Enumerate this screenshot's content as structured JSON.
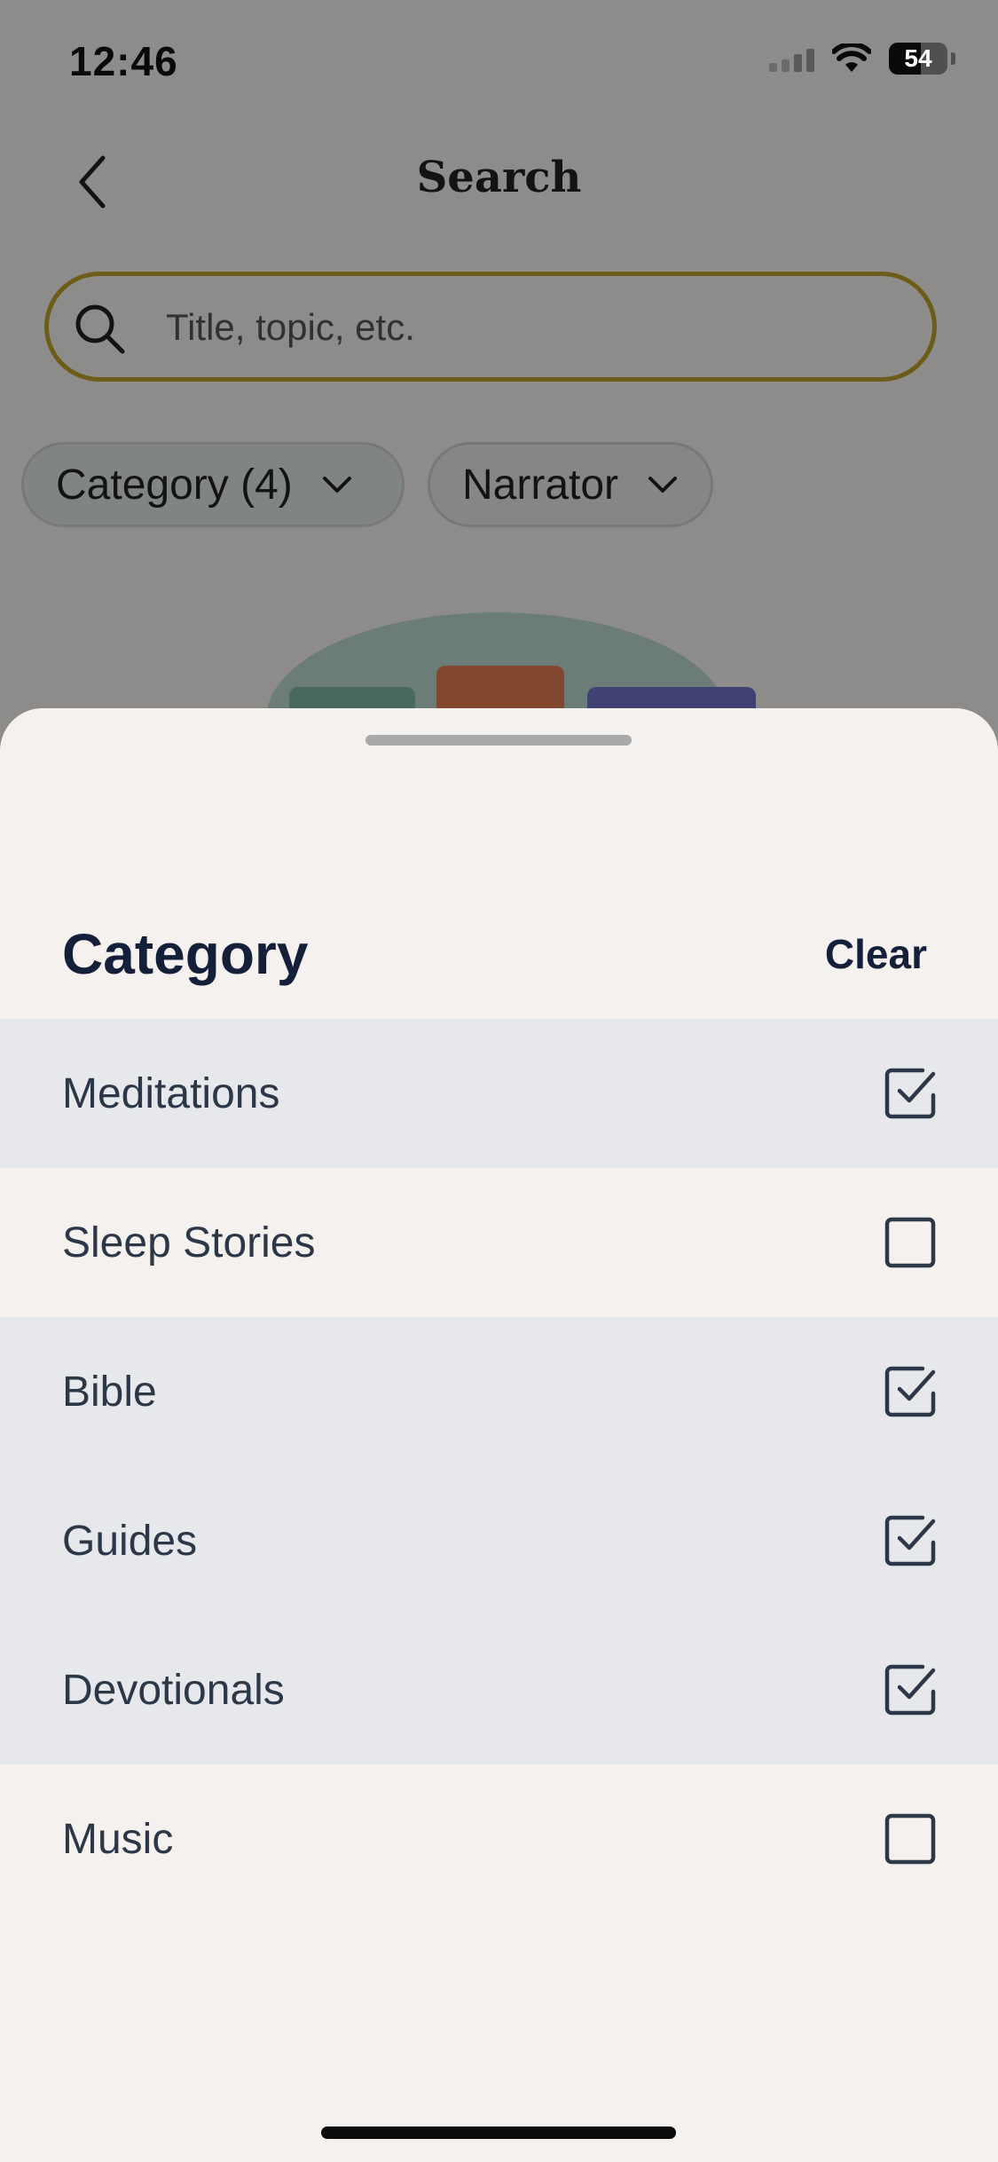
{
  "status_bar": {
    "time": "12:46",
    "battery": "54"
  },
  "nav": {
    "title": "Search"
  },
  "search": {
    "placeholder": "Title, topic, etc."
  },
  "filters": {
    "category_label": "Category (4)",
    "narrator_label": "Narrator"
  },
  "sheet": {
    "title": "Category",
    "clear_label": "Clear",
    "options": [
      {
        "label": "Meditations",
        "checked": true
      },
      {
        "label": "Sleep Stories",
        "checked": false
      },
      {
        "label": "Bible",
        "checked": true
      },
      {
        "label": "Guides",
        "checked": true
      },
      {
        "label": "Devotionals",
        "checked": true
      },
      {
        "label": "Music",
        "checked": false
      }
    ]
  },
  "icons": {
    "back": "chevron-left-icon",
    "search": "magnifier-icon",
    "chip_dropdown": "chevron-down-icon",
    "checkbox_on": "checkbox-checked-icon",
    "checkbox_off": "checkbox-empty-icon"
  },
  "colors": {
    "search_border": "#b89f2a",
    "sheet_bg": "#f5f1ee",
    "selected_row": "#e6e8eb",
    "title_text": "#14203a",
    "illus_green": "#b9d8cc",
    "illus_card_1": "#7fb3a2",
    "illus_card_2": "#e07a52",
    "illus_card_3": "#6f73c9"
  }
}
